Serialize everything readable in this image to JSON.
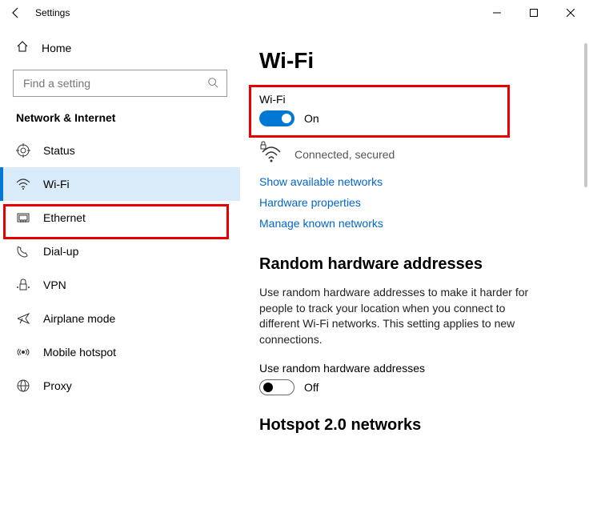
{
  "titlebar": {
    "title": "Settings"
  },
  "sidebar": {
    "home": "Home",
    "search_placeholder": "Find a setting",
    "section": "Network & Internet",
    "items": [
      {
        "label": "Status"
      },
      {
        "label": "Wi-Fi"
      },
      {
        "label": "Ethernet"
      },
      {
        "label": "Dial-up"
      },
      {
        "label": "VPN"
      },
      {
        "label": "Airplane mode"
      },
      {
        "label": "Mobile hotspot"
      },
      {
        "label": "Proxy"
      }
    ]
  },
  "main": {
    "title": "Wi-Fi",
    "wifi_label": "Wi-Fi",
    "wifi_toggle_state": "On",
    "status_text": "Connected, secured",
    "links": {
      "show_networks": "Show available networks",
      "hw_props": "Hardware properties",
      "manage_known": "Manage known networks"
    },
    "random_hw": {
      "heading": "Random hardware addresses",
      "desc": "Use random hardware addresses to make it harder for people to track your location when you connect to different Wi-Fi networks. This setting applies to new connections.",
      "toggle_label": "Use random hardware addresses",
      "toggle_state": "Off"
    },
    "hotspot": {
      "heading": "Hotspot 2.0 networks"
    }
  }
}
